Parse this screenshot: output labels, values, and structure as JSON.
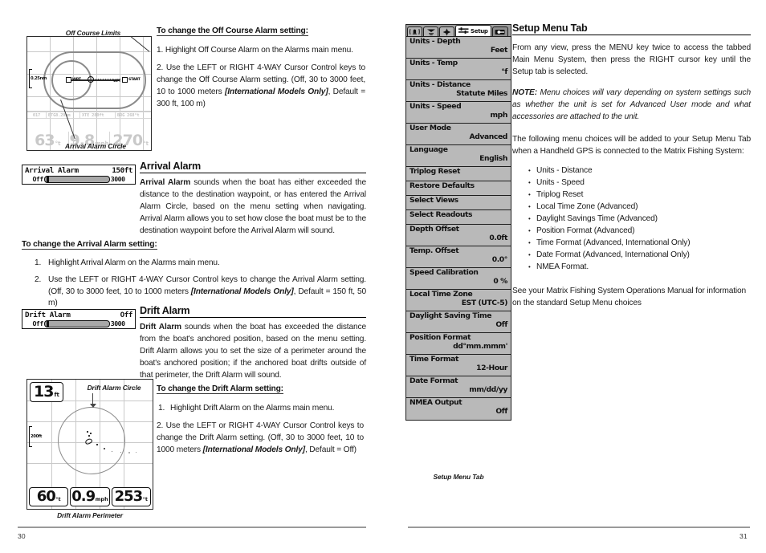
{
  "left_page": {
    "folio": "30",
    "fig_offcourse": {
      "label_top": "Off Course Limits",
      "label_bottom": "Arrival Alarm Circle",
      "scale": "0.25nm",
      "waypoints": [
        "WPT",
        "WPT",
        "START"
      ],
      "readout_top": [
        "017",
        "BTG8.29nm",
        "XTE  280ft",
        "BRG 268°t"
      ],
      "readouts": [
        {
          "value": "63",
          "unit": "°t"
        },
        {
          "value": "9.8",
          "unit": "mph"
        },
        {
          "value": "270",
          "unit": "°t"
        }
      ]
    },
    "offcourse_heading": "To change the Off Course Alarm setting:",
    "offcourse_steps": [
      "1. Highlight Off Course Alarm on the Alarms main  menu.",
      "2. Use the LEFT or RIGHT 4-WAY Cursor Control keys to change the Off Course Alarm setting. (Off, 30 to 3000 feet, 10 to 1000 meters [International Models Only], Default = 300 ft, 100 m)"
    ],
    "arrival": {
      "widget": {
        "title": "Arrival Alarm",
        "value": "150ft",
        "min_label": "Off",
        "max_label": "3000"
      },
      "heading": "Arrival Alarm",
      "lead_bold": "Arrival Alarm",
      "body": " sounds when the boat has either exceeded the distance to the destination waypoint, or has entered the Arrival Alarm Circle, based on the menu setting when navigating.  Arrival Alarm allows you to set how close the boat must be to the destination waypoint before the Arrival Alarm will sound.",
      "steps_heading": "To change the Arrival Alarm setting:",
      "step1_num": "1.",
      "step1": "Highlight Arrival Alarm on the Alarms main menu.",
      "step2_num": "2.",
      "step2_a": "Use the LEFT or RIGHT 4-WAY Cursor Control keys to change the Arrival Alarm setting. (Off, 30 to 3000 feet, 10 to 1000 meters ",
      "step2_em": "[International Models Only]",
      "step2_b": ", Default = 150 ft, 50 m)"
    },
    "drift": {
      "widget": {
        "title": "Drift Alarm",
        "value": "Off",
        "min_label": "Off",
        "max_label": "3000"
      },
      "heading": "Drift Alarm",
      "lead_bold": "Drift Alarm",
      "body": " sounds when the boat has exceeded the distance from the boat's anchored position, based on the menu setting. Drift Alarm allows you to set the size of a perimeter around the boat's anchored position; if the anchored boat drifts outside of that perimeter, the Drift Alarm will sound.",
      "steps_heading": "To change the Drift Alarm setting:",
      "step1_num": "1.",
      "step1": "Highlight Drift Alarm on the Alarms main menu.",
      "step2_num": "2.",
      "step2_a": "Use the LEFT or RIGHT 4-WAY Cursor Control keys to change the Drift Alarm setting. (Off, 30 to 3000 feet, 10 to 1000 meters ",
      "step2_em": "[International Models Only]",
      "step2_b": ", Default = Off)"
    },
    "fig_drift": {
      "label_circle": "Drift Alarm Circle",
      "caption": "Drift Alarm Perimeter",
      "depth": "13",
      "depth_unit": "ft",
      "scale": "200ft",
      "readouts": [
        {
          "value": "60",
          "unit": "°t"
        },
        {
          "value": "0.9",
          "unit": "mph"
        },
        {
          "value": "253",
          "unit": "°t"
        }
      ]
    }
  },
  "right_page": {
    "folio": "31",
    "setup_menu": {
      "caption": "Setup Menu Tab",
      "tabs": [
        {
          "icon": "alarm-bell-icon",
          "label": ""
        },
        {
          "icon": "sonar-icon",
          "label": ""
        },
        {
          "icon": "navigation-icon",
          "label": ""
        },
        {
          "icon": "setup-sliders-icon",
          "label": "Setup"
        },
        {
          "icon": "accessory-icon",
          "label": ""
        }
      ],
      "items": [
        {
          "label": "Units - Depth",
          "value": "Feet"
        },
        {
          "label": "Units - Temp",
          "value": "°f"
        },
        {
          "label": "Units - Distance",
          "value": "Statute Miles"
        },
        {
          "label": "Units - Speed",
          "value": "mph"
        },
        {
          "label": "User Mode",
          "value": "Advanced"
        },
        {
          "label": "Language",
          "value": "English"
        },
        {
          "label": "Triplog Reset",
          "value": ""
        },
        {
          "label": "Restore Defaults",
          "value": ""
        },
        {
          "label": "Select Views",
          "value": ""
        },
        {
          "label": "Select Readouts",
          "value": ""
        },
        {
          "label": "Depth Offset",
          "value": "0.0ft"
        },
        {
          "label": "Temp. Offset",
          "value": "0.0°"
        },
        {
          "label": "Speed Calibration",
          "value": "0 %"
        },
        {
          "label": "Local Time Zone",
          "value": "EST (UTC-5)"
        },
        {
          "label": "Daylight Saving Time",
          "value": "Off"
        },
        {
          "label": "Position Format",
          "value": "dd°mm.mmm'"
        },
        {
          "label": "Time Format",
          "value": "12-Hour"
        },
        {
          "label": "Date Format",
          "value": "mm/dd/yy"
        },
        {
          "label": "NMEA Output",
          "value": "Off"
        }
      ]
    },
    "heading": "Setup Menu Tab",
    "intro": "From any view, press the MENU key twice to access the tabbed Main Menu System, then press the RIGHT cursor key until the Setup tab is selected.",
    "note_label": "NOTE:",
    "note_text": " Menu choices will vary depending on system settings such as whether the unit is set for Advanced User mode and what accessories are attached to the unit.",
    "following": "The following menu choices will be added to your Setup Menu Tab when a Handheld GPS is connected to the Matrix Fishing System:",
    "bullets": [
      "Units - Distance",
      "Units - Speed",
      "Triplog Reset",
      "Local Time Zone (Advanced)",
      "Daylight Savings Time (Advanced)",
      "Position Format (Advanced)",
      "Time Format (Advanced, International Only)",
      "Date Format (Advanced, International Only)",
      "NMEA Format."
    ],
    "closing": "See your Matrix Fishing System Operations Manual for information on the standard Setup Menu choices"
  }
}
